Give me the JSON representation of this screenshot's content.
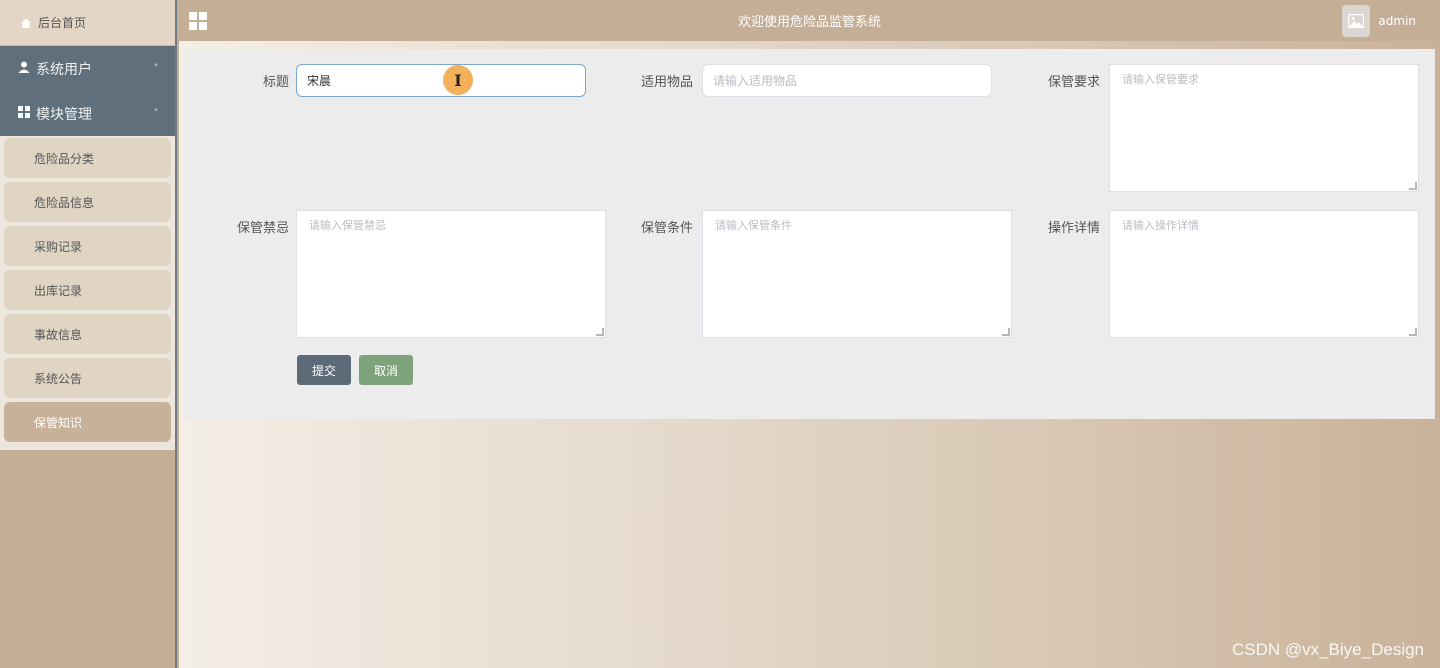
{
  "sidebar": {
    "home_label": "后台首页",
    "groups": [
      {
        "label": "系统用户",
        "chevron": "˅"
      },
      {
        "label": "模块管理",
        "chevron": "˄"
      }
    ],
    "items": [
      {
        "label": "危险品分类"
      },
      {
        "label": "危险品信息"
      },
      {
        "label": "采购记录"
      },
      {
        "label": "出库记录"
      },
      {
        "label": "事故信息"
      },
      {
        "label": "系统公告"
      },
      {
        "label": "保管知识"
      }
    ]
  },
  "topbar": {
    "title": "欢迎使用危险品监管系统",
    "username": "admin"
  },
  "form": {
    "title_label": "标题",
    "title_value": "宋晨",
    "item_label": "适用物品",
    "item_placeholder": "请输入适用物品",
    "req_label": "保管要求",
    "req_placeholder": "请输入保管要求",
    "taboo_label": "保管禁忌",
    "taboo_placeholder": "请输入保管禁忌",
    "cond_label": "保管条件",
    "cond_placeholder": "请输入保管条件",
    "detail_label": "操作详情",
    "detail_placeholder": "请输入操作详情",
    "submit_label": "提交",
    "cancel_label": "取消"
  },
  "cursor_glyph": "I",
  "watermark": "CSDN @vx_Biye_Design",
  "colors": {
    "sidebar_group": "#5f707c",
    "submit": "#5d6b78",
    "cancel": "#7ea37a",
    "cursor": "#f2b15a"
  }
}
